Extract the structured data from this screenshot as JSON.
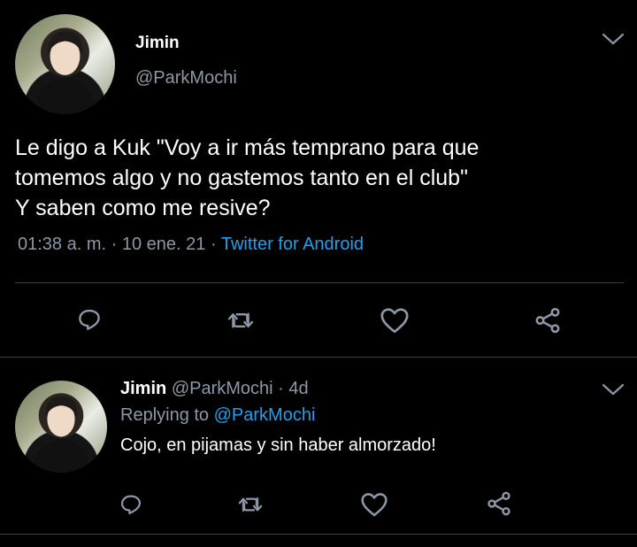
{
  "main_tweet": {
    "display_name": "Jimin",
    "handle": "@ParkMochi",
    "text_lines": [
      "Le digo a Kuk \"Voy a ir más temprano para que",
      "tomemos algo y no gastemos tanto en el club\"",
      "Y saben como me resive?"
    ],
    "time": "01:38 a. m.",
    "sep1": "·",
    "date": "10 ene. 21",
    "sep2": "·",
    "source": "Twitter for Android"
  },
  "reply": {
    "display_name": "Jimin",
    "handle": "@ParkMochi",
    "sep": "·",
    "age": "4d",
    "replying_prefix": "Replying to",
    "replying_to": "@ParkMochi",
    "text": "Cojo, en pijamas y sin haber almorzado!"
  },
  "icons": {
    "reply": "reply-icon",
    "retweet": "retweet-icon",
    "like": "heart-icon",
    "share": "share-icon",
    "more": "chevron-down-icon"
  },
  "colors": {
    "background": "#000000",
    "text": "#ffffff",
    "secondary": "#8b98a5",
    "accent": "#1da1f2",
    "divider": "#38444d"
  }
}
